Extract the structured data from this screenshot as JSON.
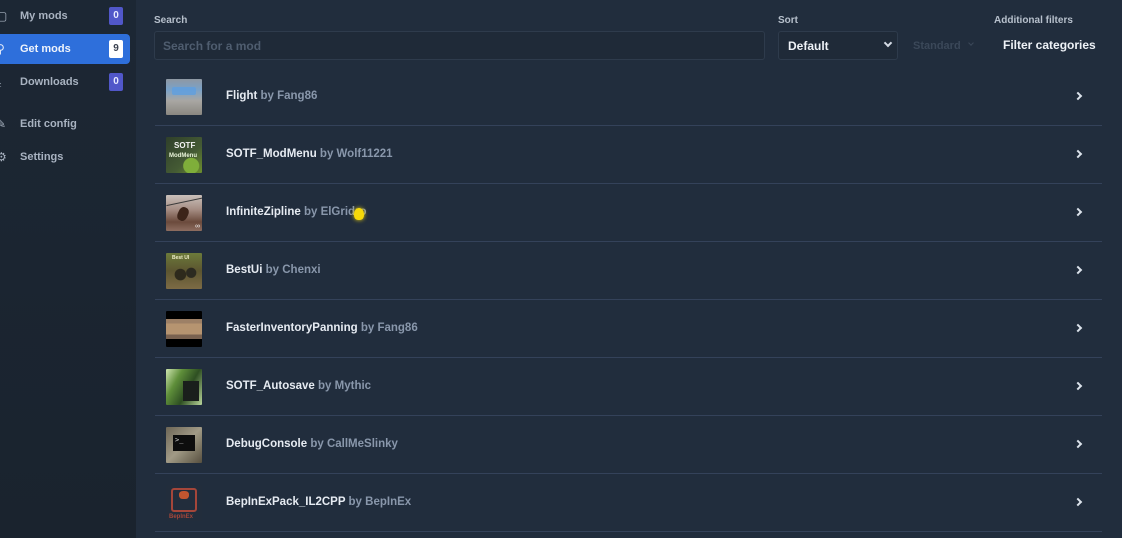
{
  "sidebar": {
    "items": [
      {
        "label": "My mods",
        "icon": "box-icon",
        "badge": "0",
        "active": false
      },
      {
        "label": "Get mods",
        "icon": "search-icon",
        "badge": "9",
        "active": true
      },
      {
        "label": "Downloads",
        "icon": "download-icon",
        "badge": "0",
        "active": false
      },
      {
        "label": "Edit config",
        "icon": "file-edit-icon",
        "badge": null,
        "active": false
      },
      {
        "label": "Settings",
        "icon": "gear-icon",
        "badge": null,
        "active": false
      }
    ]
  },
  "toolbar": {
    "search_label": "Search",
    "search_placeholder": "Search for a mod",
    "search_value": "",
    "sort_label": "Sort",
    "sort_value": "Default",
    "order_value": "Standard",
    "filters_label": "Additional filters",
    "filters_button": "Filter categories"
  },
  "mods": [
    {
      "name": "Flight",
      "by": "by Fang86",
      "thumb": "flight"
    },
    {
      "name": "SOTF_ModMenu",
      "by": "by Wolf11221",
      "thumb": "modmenu",
      "thumb_text": [
        "SOTF",
        "ModMenu"
      ]
    },
    {
      "name": "InfiniteZipline",
      "by": "by ElGridro",
      "thumb": "zip",
      "thumb_text": [
        "∞"
      ]
    },
    {
      "name": "BestUi",
      "by": "by Chenxi",
      "thumb": "bestui",
      "thumb_text": [
        "Best UI"
      ]
    },
    {
      "name": "FasterInventoryPanning",
      "by": "by Fang86",
      "thumb": "faster"
    },
    {
      "name": "SOTF_Autosave",
      "by": "by Mythic",
      "thumb": "autosave"
    },
    {
      "name": "DebugConsole",
      "by": "by CallMeSlinky",
      "thumb": "debug",
      "thumb_text": [
        ">_"
      ]
    },
    {
      "name": "BepInExPack_IL2CPP",
      "by": "by BepInEx",
      "thumb": "bepin",
      "thumb_text": [
        "BepInEx"
      ]
    }
  ],
  "colors": {
    "accent": "#2e6fdb",
    "badge": "#5157c9",
    "background": "#212d3d",
    "sidebar": "#1c2734"
  }
}
